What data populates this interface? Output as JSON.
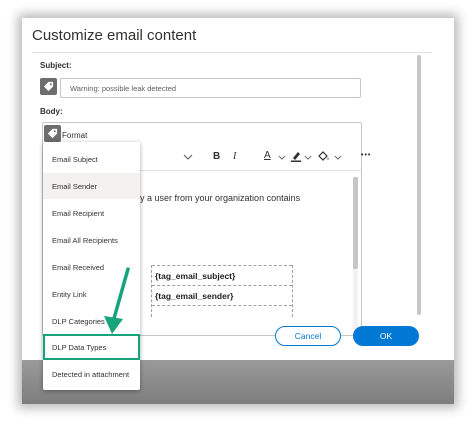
{
  "dialog": {
    "title": "Customize email content",
    "subject_label": "Subject:",
    "subject_value": "Warning: possible leak detected",
    "body_label": "Body:",
    "format_label": "Format",
    "body_text": "nt by a user from your organization contains",
    "tags": [
      "{tag_email_subject}",
      "{tag_email_sender}"
    ],
    "cancel_label": "Cancel",
    "ok_label": "OK"
  },
  "toolbar": {
    "bold": "B",
    "italic": "I",
    "font_color": "A",
    "more": "•••"
  },
  "dropdown": {
    "items": [
      "Email Subject",
      "Email Sender",
      "Email Recipient",
      "Email All Recipients",
      "Email Received",
      "Entity Link",
      "DLP Categories",
      "DLP Data Types",
      "Detected in attachment"
    ],
    "hovered_index": 1,
    "highlighted_index": 7
  },
  "colors": {
    "accent": "#0078d4",
    "highlight": "#17a37c"
  }
}
